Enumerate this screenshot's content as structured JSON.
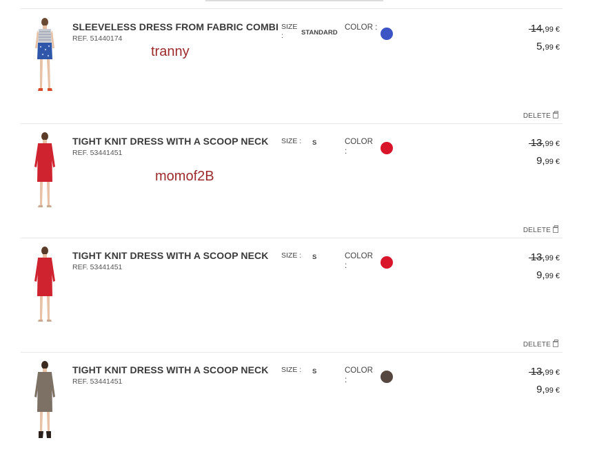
{
  "colors": {
    "blue": "#3d54c4",
    "red": "#d8152a",
    "brown": "#55473f"
  },
  "delete_label": "DELETE",
  "items": [
    {
      "name": "SLEEVELESS DRESS FROM FABRIC COMBI",
      "ref": "REF. 51440174",
      "size_label": "SIZE :",
      "size_value": "STANDARD",
      "color_label": "COLOR :",
      "swatch": "blue",
      "price_old": "14,",
      "price_old_cents": "99 €",
      "price_new": "5,",
      "price_new_cents": "99 €"
    },
    {
      "name": "TIGHT KNIT DRESS WITH A SCOOP NECK",
      "ref": "REF. 53441451",
      "size_label": "SIZE :",
      "size_value": "S",
      "color_label": "COLOR :",
      "swatch": "red",
      "price_old": "13,",
      "price_old_cents": "99 €",
      "price_new": "9,",
      "price_new_cents": "99 €"
    },
    {
      "name": "TIGHT KNIT DRESS WITH A SCOOP NECK",
      "ref": "REF. 53441451",
      "size_label": "SIZE :",
      "size_value": "S",
      "color_label": "COLOR :",
      "swatch": "red",
      "price_old": "13,",
      "price_old_cents": "99 €",
      "price_new": "9,",
      "price_new_cents": "99 €"
    },
    {
      "name": "TIGHT KNIT DRESS WITH A SCOOP NECK",
      "ref": "REF. 53441451",
      "size_label": "SIZE :",
      "size_value": "S",
      "color_label": "COLOR :",
      "swatch": "brown",
      "price_old": "13,",
      "price_old_cents": "99 €",
      "price_new": "9,",
      "price_new_cents": "99 €"
    }
  ],
  "watermarks": [
    "tranny",
    "momof2B"
  ]
}
